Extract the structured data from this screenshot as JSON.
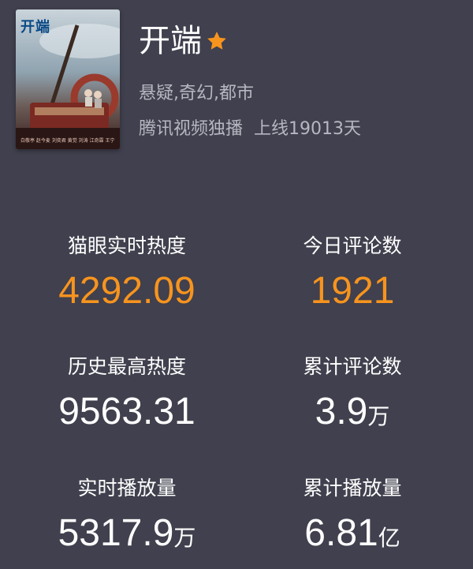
{
  "show": {
    "poster": {
      "logo_text": "开端",
      "credits_text": "白敬亭 赵今麦 刘奕君 黄觉 刘涛 江奇霖 王宁"
    },
    "title": "开端",
    "genres": "悬疑,奇幻,都市",
    "platform": "腾讯视频独播",
    "online_days": "上线19013天"
  },
  "stats": {
    "realtime_heat": {
      "label": "猫眼实时热度",
      "value": "4292.09",
      "unit": ""
    },
    "today_comments": {
      "label": "今日评论数",
      "value": "1921",
      "unit": ""
    },
    "peak_heat": {
      "label": "历史最高热度",
      "value": "9563.31",
      "unit": ""
    },
    "total_comments": {
      "label": "累计评论数",
      "value": "3.9",
      "unit": "万"
    },
    "realtime_plays": {
      "label": "实时播放量",
      "value": "5317.9",
      "unit": "万"
    },
    "total_plays": {
      "label": "累计播放量",
      "value": "6.81",
      "unit": "亿"
    }
  },
  "colors": {
    "background": "#40404e",
    "accent": "#f7941e",
    "secondary_text": "#b7b7c2",
    "star": "#f7941e"
  },
  "icons": {
    "title_badge": "star-icon"
  }
}
